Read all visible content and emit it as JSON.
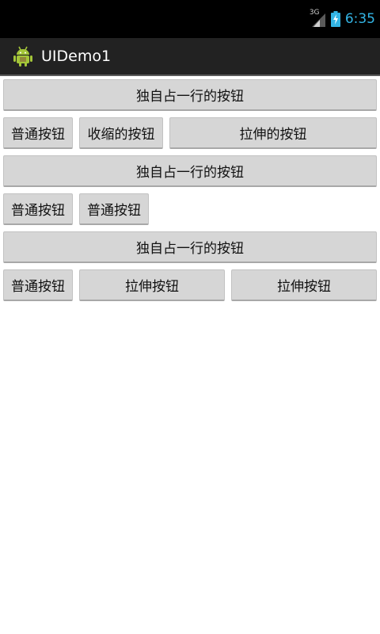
{
  "status_bar": {
    "network": "3G",
    "time": "6:35",
    "colors": {
      "background": "#000000",
      "clock": "#33b5e5"
    },
    "icons": [
      "signal-3g-icon",
      "battery-charging-icon"
    ]
  },
  "action_bar": {
    "title": "UIDemo1",
    "icon": "android-app-icon",
    "colors": {
      "background": "#222222",
      "title": "#ffffff"
    }
  },
  "rows": [
    {
      "buttons": [
        {
          "label": "独自占一行的按钮"
        }
      ]
    },
    {
      "buttons": [
        {
          "label": "普通按钮"
        },
        {
          "label": "收缩的按钮"
        },
        {
          "label": "拉伸的按钮"
        }
      ]
    },
    {
      "buttons": [
        {
          "label": "独自占一行的按钮"
        }
      ]
    },
    {
      "buttons": [
        {
          "label": "普通按钮"
        },
        {
          "label": "普通按钮"
        }
      ]
    },
    {
      "buttons": [
        {
          "label": "独自占一行的按钮"
        }
      ]
    },
    {
      "buttons": [
        {
          "label": "普通按钮"
        },
        {
          "label": "拉伸按钮"
        },
        {
          "label": "拉伸按钮"
        }
      ]
    }
  ],
  "colors": {
    "button_background": "#d6d6d6",
    "page_background": "#ffffff"
  }
}
